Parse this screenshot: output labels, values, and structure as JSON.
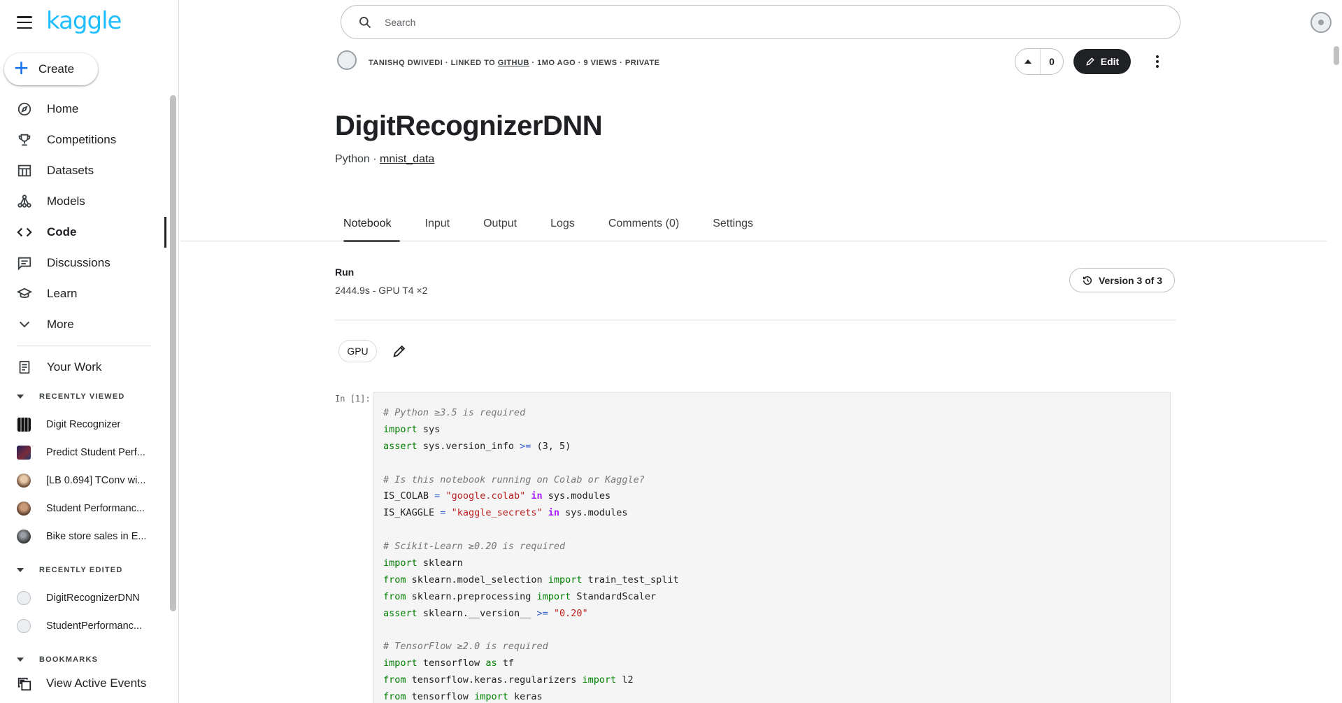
{
  "app": {
    "logo": "kaggle"
  },
  "sidebar": {
    "create_label": "Create",
    "items": [
      {
        "label": "Home",
        "icon": "compass-icon"
      },
      {
        "label": "Competitions",
        "icon": "trophy-icon"
      },
      {
        "label": "Datasets",
        "icon": "table-icon"
      },
      {
        "label": "Models",
        "icon": "models-icon"
      },
      {
        "label": "Code",
        "icon": "code-icon",
        "active": true
      },
      {
        "label": "Discussions",
        "icon": "discussions-icon"
      },
      {
        "label": "Learn",
        "icon": "learn-icon"
      },
      {
        "label": "More",
        "icon": "chevron-down-icon"
      }
    ],
    "your_work": "Your Work",
    "recently_viewed_title": "RECENTLY VIEWED",
    "recently_viewed": [
      "Digit Recognizer",
      "Predict Student Perf...",
      "[LB 0.694] TConv wi...",
      "Student Performanc...",
      "Bike store sales in E..."
    ],
    "recently_edited_title": "RECENTLY EDITED",
    "recently_edited": [
      "DigitRecognizerDNN",
      "StudentPerformanc..."
    ],
    "bookmarks_title": "BOOKMARKS",
    "view_active_events": "View Active Events"
  },
  "search": {
    "placeholder": "Search"
  },
  "notebook": {
    "author": "TANISHQ DWIVEDI",
    "linked_prefix": " · LINKED TO ",
    "linked_to": "GITHUB",
    "age": " · 1MO AGO",
    "views": " · 9 VIEWS",
    "visibility": " · PRIVATE",
    "votes": "0",
    "edit_label": "Edit",
    "title": "DigitRecognizerDNN",
    "language": "Python",
    "separator": " · ",
    "dataset": "mnist_data",
    "tabs": [
      "Notebook",
      "Input",
      "Output",
      "Logs",
      "Comments (0)",
      "Settings"
    ],
    "run_label": "Run",
    "run_value": "2444.9s - GPU T4 ×2",
    "version_label": "Version 3 of 3",
    "accelerator_chip": "GPU",
    "cell_prompt": "In [1]:"
  }
}
